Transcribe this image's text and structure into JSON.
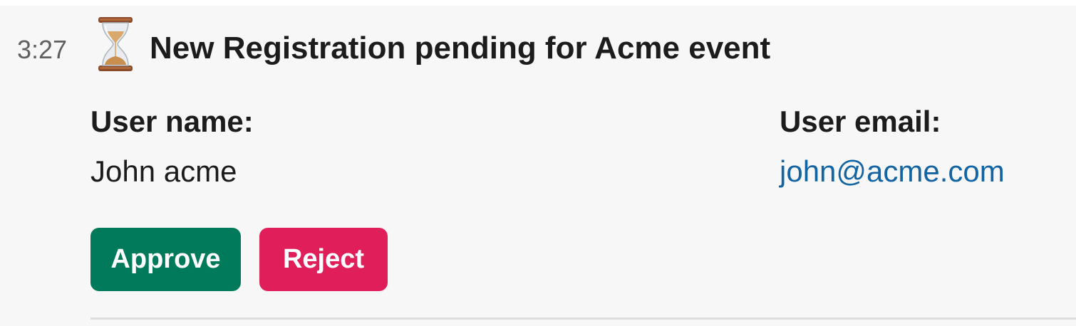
{
  "message": {
    "time": "3:27",
    "icon": "hourglass-icon",
    "title": "New Registration pending for Acme event"
  },
  "fields": {
    "user_name_label": "User name:",
    "user_name_value": "John acme",
    "user_email_label": "User email:",
    "user_email_value": "john@acme.com"
  },
  "actions": {
    "approve_label": "Approve",
    "reject_label": "Reject"
  },
  "colors": {
    "approve": "#007a5a",
    "reject": "#e01e5a",
    "link": "#1264a3",
    "background": "#f7f7f7"
  }
}
